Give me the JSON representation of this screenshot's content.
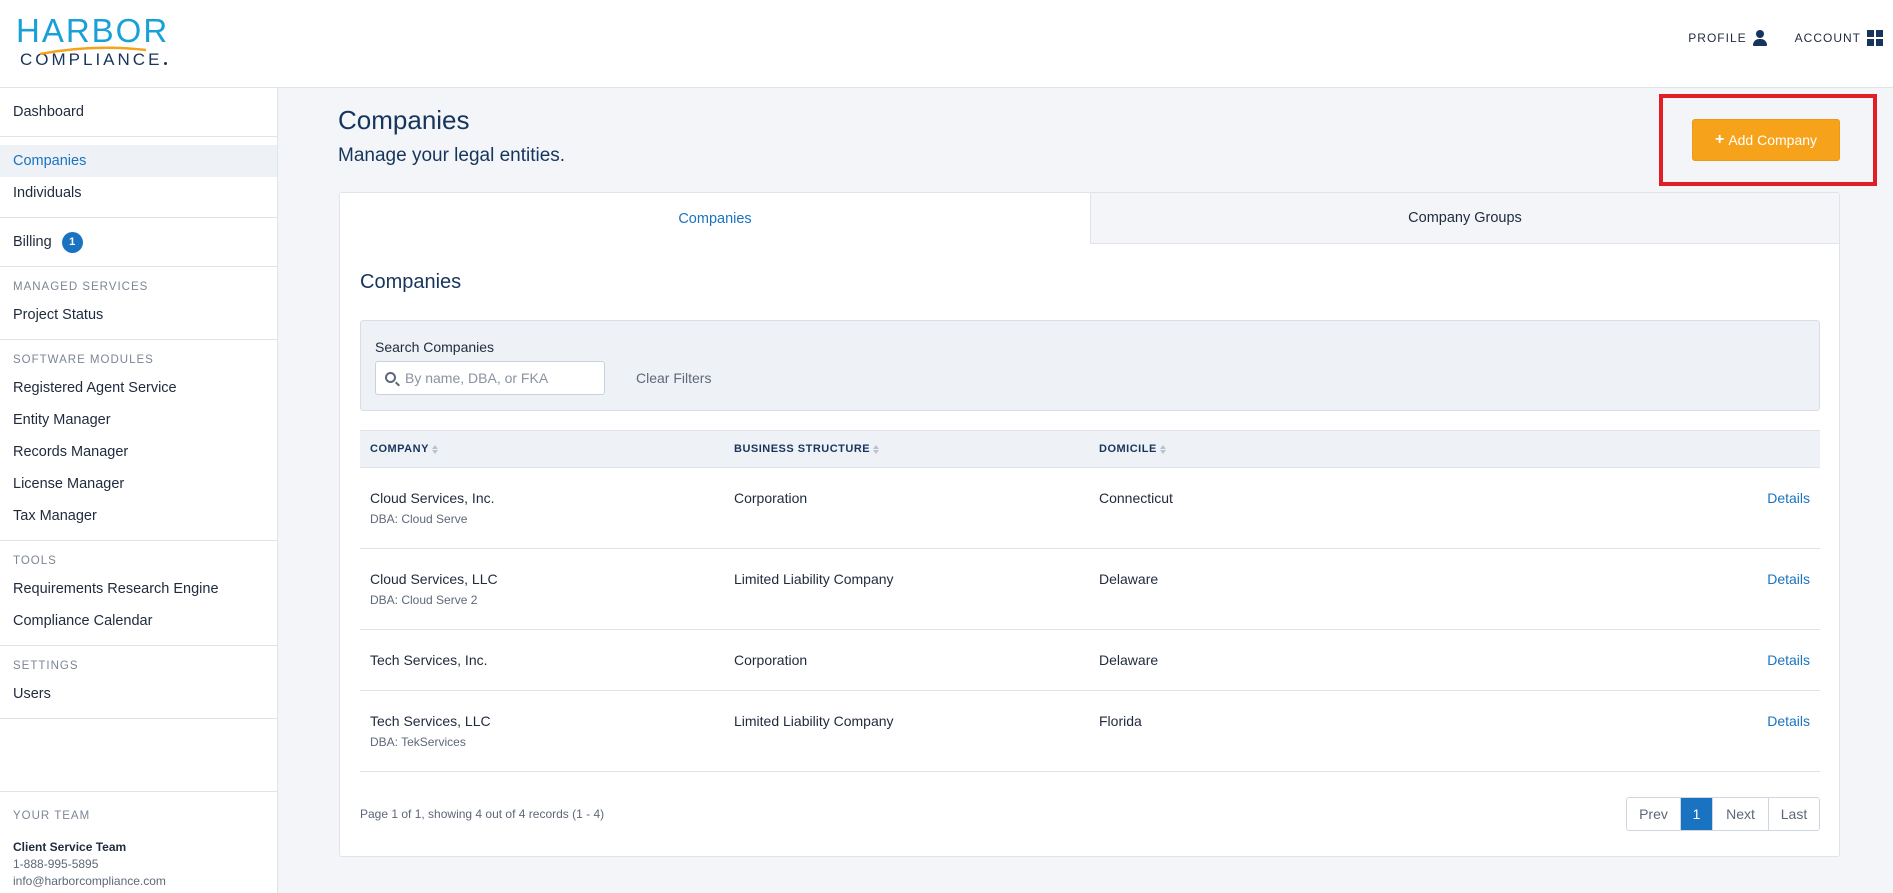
{
  "header": {
    "logo_top": "HARBOR",
    "logo_bottom": "COMPLIANCE",
    "profile_label": "PROFILE",
    "account_label": "ACCOUNT"
  },
  "sidebar": {
    "dashboard": "Dashboard",
    "companies": "Companies",
    "individuals": "Individuals",
    "billing": "Billing",
    "billing_badge": "1",
    "managed_services_heading": "MANAGED SERVICES",
    "project_status": "Project Status",
    "software_modules_heading": "SOFTWARE MODULES",
    "registered_agent": "Registered Agent Service",
    "entity_manager": "Entity Manager",
    "records_manager": "Records Manager",
    "license_manager": "License Manager",
    "tax_manager": "Tax Manager",
    "tools_heading": "TOOLS",
    "requirements_engine": "Requirements Research Engine",
    "compliance_calendar": "Compliance Calendar",
    "settings_heading": "SETTINGS",
    "users": "Users",
    "team_heading": "YOUR TEAM",
    "team_name": "Client Service Team",
    "team_phone": "1-888-995-5895",
    "team_email": "info@harborcompliance.com"
  },
  "main": {
    "title": "Companies",
    "subtitle": "Manage your legal entities.",
    "add_button": "Add Company",
    "tabs": [
      {
        "label": "Companies",
        "active": true
      },
      {
        "label": "Company Groups",
        "active": false
      }
    ],
    "section_title": "Companies",
    "search_label": "Search Companies",
    "search_placeholder": "By name, DBA, or FKA",
    "search_value": "",
    "clear_filters": "Clear Filters",
    "columns": [
      "COMPANY",
      "BUSINESS STRUCTURE",
      "DOMICILE"
    ],
    "rows": [
      {
        "company": "Cloud Services, Inc.",
        "dba": "DBA: Cloud Serve",
        "structure": "Corporation",
        "domicile": "Connecticut",
        "action": "Details"
      },
      {
        "company": "Cloud Services, LLC",
        "dba": "DBA: Cloud Serve 2",
        "structure": "Limited Liability Company",
        "domicile": "Delaware",
        "action": "Details"
      },
      {
        "company": "Tech Services, Inc.",
        "dba": "",
        "structure": "Corporation",
        "domicile": "Delaware",
        "action": "Details"
      },
      {
        "company": "Tech Services, LLC",
        "dba": "DBA: TekServices",
        "structure": "Limited Liability Company",
        "domicile": "Florida",
        "action": "Details"
      }
    ],
    "paging_text": "Page 1 of 1, showing 4 out of 4 records (1 - 4)",
    "pager": {
      "prev": "Prev",
      "current": "1",
      "next": "Next",
      "last": "Last"
    }
  },
  "colors": {
    "brand_blue": "#1aa0d8",
    "navy": "#17355c",
    "link_blue": "#1a73c0",
    "accent_orange": "#f6a31b",
    "highlight_red": "#e11e26"
  }
}
